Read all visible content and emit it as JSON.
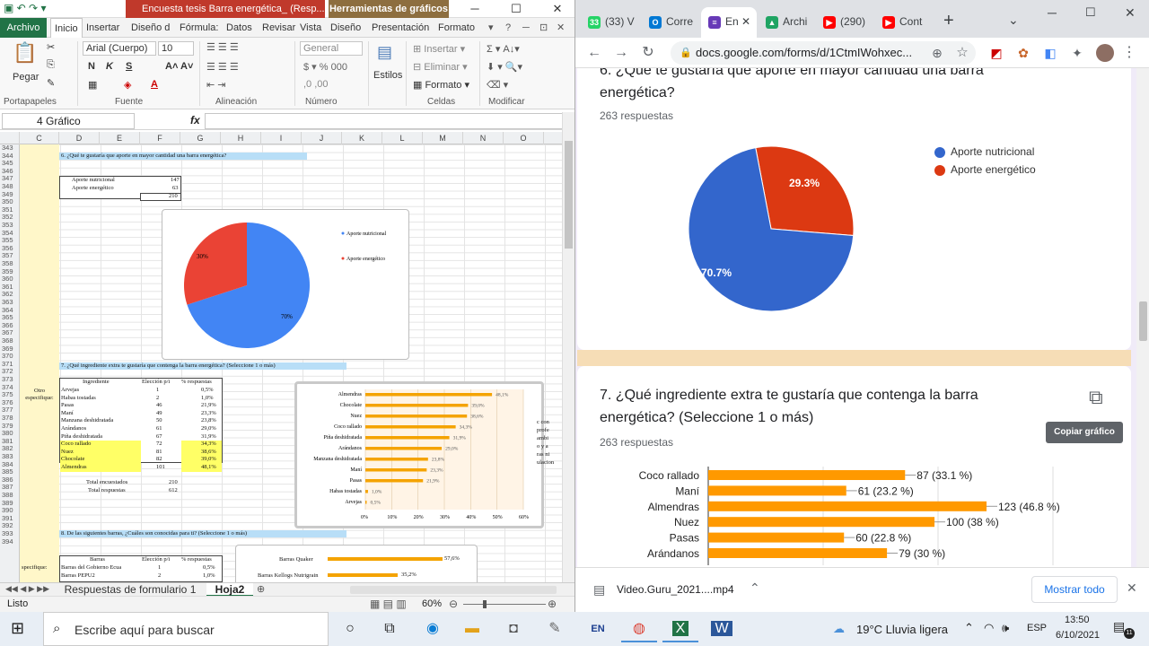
{
  "excel": {
    "title_doc": "Encuesta tesis Barra energética_ (Resp...",
    "tools_tab": "Herramientas de gráficos",
    "tabs": [
      "Archivo",
      "Inicio",
      "Insertar",
      "Diseño d",
      "Fórmula:",
      "Datos",
      "Revisar",
      "Vista",
      "Diseño",
      "Presentación",
      "Formato"
    ],
    "ribbon": {
      "pegar": "Pegar",
      "font_name": "Arial (Cuerpo)",
      "font_size": "10",
      "format_general": "General",
      "estilos": "Estilos",
      "insertar": "Insertar",
      "eliminar": "Eliminar",
      "formato": "Formato",
      "groups": [
        "Portapapeles",
        "Fuente",
        "Alineación",
        "Número",
        "Celdas",
        "Modificar"
      ]
    },
    "namebox": "4 Gráfico",
    "fx": "fx",
    "columns": [
      "C",
      "D",
      "E",
      "F",
      "G",
      "H",
      "I",
      "J",
      "K",
      "L",
      "M",
      "N",
      "O"
    ],
    "rows": [
      "343",
      "344",
      "345",
      "346",
      "347",
      "348",
      "349",
      "350",
      "351",
      "352",
      "353",
      "354",
      "355",
      "356",
      "357",
      "358",
      "359",
      "360",
      "361",
      "362",
      "363",
      "364",
      "365",
      "366",
      "367",
      "368",
      "369",
      "370",
      "371",
      "372",
      "373",
      "374",
      "375",
      "376",
      "377",
      "378",
      "379",
      "380",
      "381",
      "382",
      "383",
      "384",
      "385",
      "386",
      "387",
      "388",
      "389",
      "390",
      "391",
      "392",
      "393",
      "394"
    ],
    "q6_header": "6. ¿Qué te gustaría que aporte en mayor cantidad una barra energética?",
    "q6_table": [
      [
        "Aporte nutricional",
        "147"
      ],
      [
        "Aporte energético",
        "63"
      ],
      [
        "",
        "210"
      ]
    ],
    "pie": {
      "legend": [
        "Aporte nutricional",
        "Aporte energético"
      ],
      "labels": [
        "30%",
        "70%"
      ],
      "values": [
        70,
        30
      ],
      "colors": [
        "#4285f4",
        "#ea4335"
      ]
    },
    "q7_header": "7. ¿Qué ingrediente extra te gustaría que contenga la barra energética? (Seleccione 1 o más)",
    "q7_cols": [
      "Ingrediente",
      "Elección p/i",
      "% respuestas"
    ],
    "q7_label": "Otro especifique:",
    "q7_rows": [
      [
        "Arvejas",
        "1",
        "0,5%"
      ],
      [
        "Habas tostadas",
        "2",
        "1,0%"
      ],
      [
        "Pasas",
        "46",
        "21,9%"
      ],
      [
        "Maní",
        "49",
        "23,3%"
      ],
      [
        "Manzana deshidratada",
        "50",
        "23,8%"
      ],
      [
        "Arándanos",
        "61",
        "29,0%"
      ],
      [
        "Piña deshidratada",
        "67",
        "31,9%"
      ],
      [
        "Coco rallado",
        "72",
        "34,3%"
      ],
      [
        "Nuez",
        "81",
        "38,6%"
      ],
      [
        "Chocolate",
        "82",
        "39,0%"
      ],
      [
        "Almendras",
        "101",
        "48,1%"
      ]
    ],
    "q7_totals": [
      [
        "Total encuestados",
        "210"
      ],
      [
        "Total respuestas",
        "612"
      ]
    ],
    "bar_labels": [
      "Almendras",
      "Chocolate",
      "Nuez",
      "Coco rallado",
      "Piña deshidratada",
      "Arándanos",
      "Manzana deshidratada",
      "Maní",
      "Pasas",
      "Habas tostadas",
      "Arvejas"
    ],
    "bar_values": [
      48.1,
      39.0,
      38.6,
      34.3,
      31.9,
      29.0,
      23.8,
      23.3,
      21.9,
      1.0,
      0.5
    ],
    "bar_value_labels": [
      "48,1%",
      "39,0%",
      "38,6%",
      "34,3%",
      "31,9%",
      "29,0%",
      "23,8%",
      "23,3%",
      "21,9%",
      "1,0%",
      "0,5%"
    ],
    "bar_axis": [
      "0%",
      "10%",
      "20%",
      "30%",
      "40%",
      "50%",
      "60%"
    ],
    "q8_header": "8. De las siguientes barras, ¿Cuáles son conocidas para ti? (Seleccione 1 o más)",
    "q8_cols": [
      "Barras",
      "Elección p/i",
      "% respuestas"
    ],
    "q8_rows": [
      [
        "Barras del Gobierno Ecua",
        "1",
        "0,5%"
      ],
      [
        "Barras PEPU2",
        "2",
        "1,0%"
      ]
    ],
    "q8_label": "specifique:",
    "q8_bars": [
      [
        "Barras Quaker",
        "57,6%"
      ],
      [
        "Barras Kellogs Nutrigrain",
        "35,2%"
      ]
    ],
    "side_text": [
      "c con",
      "profe",
      "ambi",
      "o y a",
      "ras ni",
      "ulacion"
    ],
    "sheet_tabs": [
      "Respuestas de formulario 1",
      "Hoja2"
    ],
    "status": "Listo",
    "zoom": "60%"
  },
  "chrome": {
    "tabs": [
      {
        "label": "(33) V",
        "color": "#25d366",
        "icon": "33"
      },
      {
        "label": "Corre",
        "color": "#0078d4",
        "icon": "O"
      },
      {
        "label": "En",
        "color": "#673ab7",
        "icon": "≡"
      },
      {
        "label": "Archi",
        "color": "#1fa463",
        "icon": "▲"
      },
      {
        "label": "(290)",
        "color": "#ff0000",
        "icon": "▶"
      },
      {
        "label": "Cont",
        "color": "#ff0000",
        "icon": "▶"
      }
    ],
    "url": "docs.google.com/forms/d/1CtmIWohxec...",
    "q6_title": "6. ¿Qué te gustaría que aporte en mayor cantidad una barra energética?",
    "q6_responses": "263 respuestas",
    "q6_legend": [
      "Aporte nutricional",
      "Aporte energético"
    ],
    "q6_pie_labels": [
      "70.7%",
      "29.3%"
    ],
    "q6_values": [
      70.7,
      29.3
    ],
    "q6_colors": [
      "#3366cc",
      "#dc3912"
    ],
    "q7_title": "7. ¿Qué ingrediente extra te gustaría que contenga la barra energética? (Seleccione 1 o más)",
    "q7_responses": "263 respuestas",
    "copy_chart": "Copiar gráfico",
    "bars": [
      [
        "Coco rallado",
        87,
        "87 (33.1 %)"
      ],
      [
        "Maní",
        61,
        "61 (23.2 %)"
      ],
      [
        "Almendras",
        123,
        "123 (46.8 %)"
      ],
      [
        "Nuez",
        100,
        "100 (38 %)"
      ],
      [
        "Pasas",
        60,
        "60 (22.8 %)"
      ],
      [
        "Arándanos",
        79,
        "79 (30 %)"
      ]
    ],
    "download_file": "Video.Guru_2021....mp4",
    "show_all": "Mostrar todo"
  },
  "taskbar": {
    "search": "Escribe aquí para buscar",
    "weather": "19°C  Lluvia ligera",
    "lang": "ESP",
    "time": "13:50",
    "date": "6/10/2021",
    "notif": "11"
  }
}
